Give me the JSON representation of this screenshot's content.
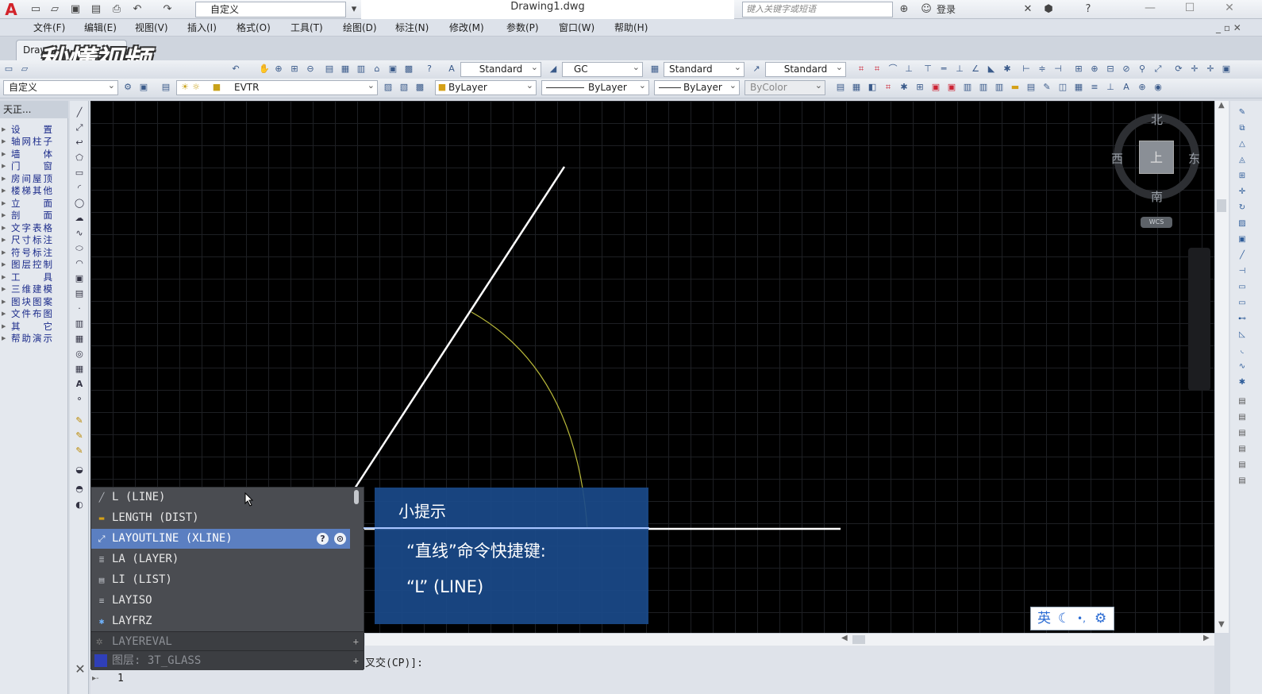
{
  "titlebar": {
    "workspace": "自定义",
    "file_title": "Drawing1.dwg",
    "search_placeholder": "键入关键字或短语",
    "login": "登录"
  },
  "menu": [
    "文件(F)",
    "编辑(E)",
    "视图(V)",
    "插入(I)",
    "格式(O)",
    "工具(T)",
    "绘图(D)",
    "标注(N)",
    "修改(M)",
    "参数(P)",
    "窗口(W)",
    "帮助(H)"
  ],
  "tabs": {
    "doc_tab": "Draw"
  },
  "watermark": "秒懂视频",
  "toolbar1": {
    "text_style": "Standard",
    "dim_style": "GC",
    "table_style": "Standard",
    "multileader_style": "Standard"
  },
  "toolbar2": {
    "workspace": "自定义",
    "layer": "EVTR",
    "color": "ByLayer",
    "linetype": "ByLayer",
    "lineweight": "ByLayer",
    "plotstyle": "ByColor"
  },
  "left_panel": {
    "header": "天正...",
    "items": [
      "设　　置",
      "轴网柱子",
      "墙　　体",
      "门　　窗",
      "房间屋顶",
      "楼梯其他",
      "立　　面",
      "剖　　面",
      "文字表格",
      "尺寸标注",
      "符号标注",
      "图层控制",
      "工　　具",
      "三维建模",
      "图块图案",
      "文件布图",
      "其　　它",
      "帮助演示"
    ]
  },
  "viewcube": {
    "north": "北",
    "south": "南",
    "east": "东",
    "west": "西",
    "face": "上",
    "wcs": "WCS"
  },
  "autocomplete": {
    "items": [
      {
        "label": "L (LINE)",
        "icon": "line-icon"
      },
      {
        "label": "LENGTH (DIST)",
        "icon": "dist-icon"
      },
      {
        "label": "LAYOUTLINE (XLINE)",
        "icon": "xline-icon",
        "selected": true
      },
      {
        "label": "LA (LAYER)",
        "icon": "layer-icon"
      },
      {
        "label": "LI (LIST)",
        "icon": "list-icon"
      },
      {
        "label": "LAYISO",
        "icon": "layiso-icon"
      },
      {
        "label": "LAYFRZ",
        "icon": "layfrz-icon"
      }
    ],
    "sections": [
      {
        "label": "LAYEREVAL"
      },
      {
        "label": "图层: 3T_GLASS"
      }
    ]
  },
  "tip": {
    "title": "小提示",
    "line1": "“直线”命令快捷键:",
    "line2": "“L” (LINE)"
  },
  "command": {
    "prompt": "叉交(CP)]:",
    "input": "1"
  },
  "ime": {
    "lang": "英"
  },
  "colors": {
    "canvas": "#000000",
    "tip_bg": "#1a4a8a",
    "selection": "#5b7fc1",
    "arc": "#b9b93a"
  }
}
